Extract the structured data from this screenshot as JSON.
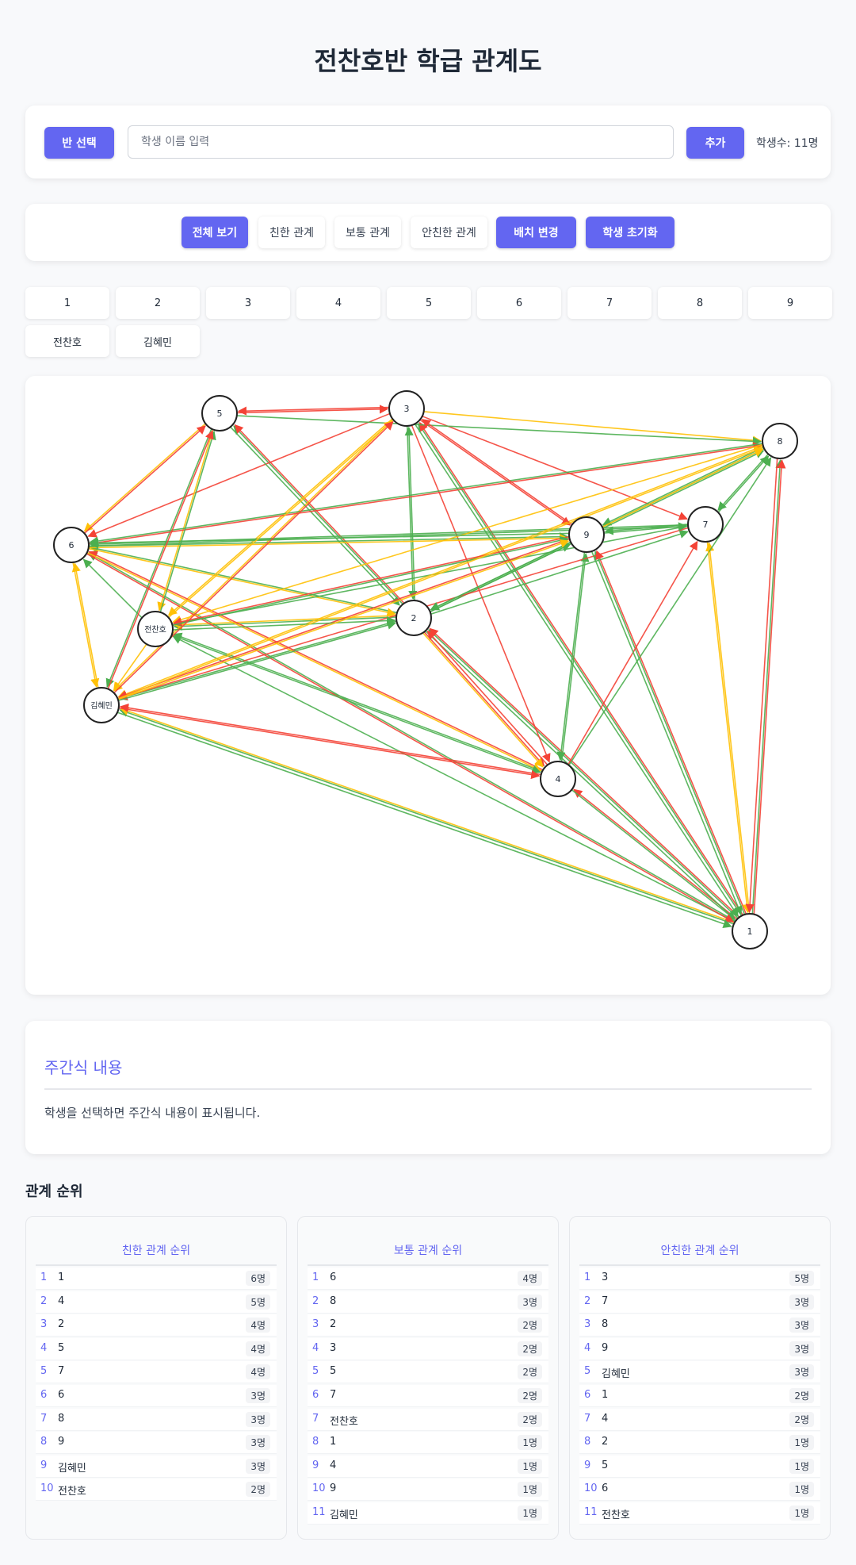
{
  "page": {
    "title": "전찬호반 학급 관계도"
  },
  "controls": {
    "class_select_label": "반 선택",
    "name_placeholder": "학생 이름 입력",
    "add_label": "추가",
    "student_count": "학생수: 11명"
  },
  "filters": {
    "all": "전체 보기",
    "close": "친한 관계",
    "normal": "보통 관계",
    "distant": "안친한 관계",
    "rearrange": "배치 변경",
    "reset": "학생 초기화"
  },
  "students": [
    "1",
    "2",
    "3",
    "4",
    "5",
    "6",
    "7",
    "8",
    "9",
    "전찬호",
    "김혜민"
  ],
  "colors": {
    "accent": "#6366f1",
    "close": "#4caf50",
    "normal": "#ffc107",
    "distant": "#f44336"
  },
  "graph": {
    "edges": [
      [
        "1",
        "8",
        "close"
      ],
      [
        "1",
        "8",
        "distant"
      ],
      [
        "1",
        "7",
        "normal"
      ],
      [
        "1",
        "9",
        "close"
      ],
      [
        "1",
        "9",
        "distant"
      ],
      [
        "1",
        "3",
        "close"
      ],
      [
        "1",
        "3",
        "distant"
      ],
      [
        "1",
        "4",
        "distant"
      ],
      [
        "1",
        "2",
        "close"
      ],
      [
        "1",
        "2",
        "distant"
      ],
      [
        "1",
        "6",
        "close"
      ],
      [
        "1",
        "전찬호",
        "close"
      ],
      [
        "1",
        "김혜민",
        "close"
      ],
      [
        "1",
        "김혜민",
        "normal"
      ],
      [
        "2",
        "3",
        "close"
      ],
      [
        "2",
        "5",
        "close"
      ],
      [
        "2",
        "5",
        "distant"
      ],
      [
        "2",
        "9",
        "close"
      ],
      [
        "2",
        "7",
        "close"
      ],
      [
        "2",
        "전찬호",
        "close"
      ],
      [
        "2",
        "전찬호",
        "normal"
      ],
      [
        "2",
        "김혜민",
        "close"
      ],
      [
        "2",
        "4",
        "distant"
      ],
      [
        "2",
        "4",
        "normal"
      ],
      [
        "2",
        "6",
        "close"
      ],
      [
        "2",
        "8",
        "close"
      ],
      [
        "2",
        "1",
        "close"
      ],
      [
        "3",
        "5",
        "distant"
      ],
      [
        "3",
        "8",
        "normal"
      ],
      [
        "3",
        "9",
        "distant"
      ],
      [
        "3",
        "7",
        "distant"
      ],
      [
        "3",
        "4",
        "distant"
      ],
      [
        "3",
        "6",
        "distant"
      ],
      [
        "3",
        "김혜민",
        "normal"
      ],
      [
        "3",
        "전찬호",
        "normal"
      ],
      [
        "3",
        "2",
        "close"
      ],
      [
        "3",
        "1",
        "close"
      ],
      [
        "4",
        "7",
        "distant"
      ],
      [
        "4",
        "8",
        "close"
      ],
      [
        "4",
        "9",
        "close"
      ],
      [
        "4",
        "김혜민",
        "distant"
      ],
      [
        "4",
        "6",
        "distant"
      ],
      [
        "4",
        "전찬호",
        "close"
      ],
      [
        "4",
        "2",
        "distant"
      ],
      [
        "4",
        "1",
        "close"
      ],
      [
        "5",
        "3",
        "distant"
      ],
      [
        "5",
        "8",
        "close"
      ],
      [
        "5",
        "6",
        "normal"
      ],
      [
        "5",
        "김혜민",
        "close"
      ],
      [
        "5",
        "전찬호",
        "normal"
      ],
      [
        "5",
        "2",
        "close"
      ],
      [
        "6",
        "8",
        "distant"
      ],
      [
        "6",
        "9",
        "close"
      ],
      [
        "6",
        "9",
        "normal"
      ],
      [
        "6",
        "7",
        "close"
      ],
      [
        "6",
        "5",
        "distant"
      ],
      [
        "6",
        "김혜민",
        "normal"
      ],
      [
        "6",
        "4",
        "normal"
      ],
      [
        "6",
        "2",
        "normal"
      ],
      [
        "6",
        "1",
        "distant"
      ],
      [
        "7",
        "8",
        "close"
      ],
      [
        "7",
        "9",
        "close"
      ],
      [
        "7",
        "김혜민",
        "distant"
      ],
      [
        "7",
        "전찬호",
        "close"
      ],
      [
        "7",
        "6",
        "close"
      ],
      [
        "7",
        "1",
        "normal"
      ],
      [
        "8",
        "7",
        "close"
      ],
      [
        "8",
        "9",
        "close"
      ],
      [
        "8",
        "6",
        "close"
      ],
      [
        "8",
        "전찬호",
        "normal"
      ],
      [
        "8",
        "김혜민",
        "normal"
      ],
      [
        "8",
        "2",
        "close"
      ],
      [
        "8",
        "1",
        "distant"
      ],
      [
        "9",
        "2",
        "close"
      ],
      [
        "9",
        "3",
        "distant"
      ],
      [
        "9",
        "전찬호",
        "distant"
      ],
      [
        "9",
        "김혜민",
        "distant"
      ],
      [
        "9",
        "6",
        "close"
      ],
      [
        "9",
        "1",
        "close"
      ],
      [
        "9",
        "4",
        "close"
      ],
      [
        "9",
        "7",
        "close"
      ],
      [
        "9",
        "8",
        "normal"
      ],
      [
        "전찬호",
        "2",
        "close"
      ],
      [
        "전찬호",
        "9",
        "close"
      ],
      [
        "전찬호",
        "5",
        "close"
      ],
      [
        "전찬호",
        "4",
        "close"
      ],
      [
        "전찬호",
        "김혜민",
        "normal"
      ],
      [
        "전찬호",
        "3",
        "normal"
      ],
      [
        "전찬호",
        "6",
        "close"
      ],
      [
        "김혜민",
        "6",
        "normal"
      ],
      [
        "김혜민",
        "3",
        "distant"
      ],
      [
        "김혜민",
        "9",
        "normal"
      ],
      [
        "김혜민",
        "4",
        "distant"
      ],
      [
        "김혜민",
        "5",
        "distant"
      ],
      [
        "김혜민",
        "8",
        "normal"
      ],
      [
        "김혜민",
        "2",
        "close"
      ],
      [
        "김혜민",
        "1",
        "close"
      ]
    ]
  },
  "journal": {
    "title": "주간식 내용",
    "placeholder": "학생을 선택하면 주간식 내용이 표시됩니다."
  },
  "ranking": {
    "heading": "관계 순위",
    "close": {
      "title": "친한 관계 순위",
      "rows": [
        {
          "rank": "1",
          "name": "1",
          "count": "6명"
        },
        {
          "rank": "2",
          "name": "4",
          "count": "5명"
        },
        {
          "rank": "3",
          "name": "2",
          "count": "4명"
        },
        {
          "rank": "4",
          "name": "5",
          "count": "4명"
        },
        {
          "rank": "5",
          "name": "7",
          "count": "4명"
        },
        {
          "rank": "6",
          "name": "6",
          "count": "3명"
        },
        {
          "rank": "7",
          "name": "8",
          "count": "3명"
        },
        {
          "rank": "8",
          "name": "9",
          "count": "3명"
        },
        {
          "rank": "9",
          "name": "김혜민",
          "count": "3명"
        },
        {
          "rank": "10",
          "name": "전찬호",
          "count": "2명"
        }
      ]
    },
    "normal": {
      "title": "보통 관계 순위",
      "rows": [
        {
          "rank": "1",
          "name": "6",
          "count": "4명"
        },
        {
          "rank": "2",
          "name": "8",
          "count": "3명"
        },
        {
          "rank": "3",
          "name": "2",
          "count": "2명"
        },
        {
          "rank": "4",
          "name": "3",
          "count": "2명"
        },
        {
          "rank": "5",
          "name": "5",
          "count": "2명"
        },
        {
          "rank": "6",
          "name": "7",
          "count": "2명"
        },
        {
          "rank": "7",
          "name": "전찬호",
          "count": "2명"
        },
        {
          "rank": "8",
          "name": "1",
          "count": "1명"
        },
        {
          "rank": "9",
          "name": "4",
          "count": "1명"
        },
        {
          "rank": "10",
          "name": "9",
          "count": "1명"
        },
        {
          "rank": "11",
          "name": "김혜민",
          "count": "1명"
        }
      ]
    },
    "distant": {
      "title": "안친한 관계 순위",
      "rows": [
        {
          "rank": "1",
          "name": "3",
          "count": "5명"
        },
        {
          "rank": "2",
          "name": "7",
          "count": "3명"
        },
        {
          "rank": "3",
          "name": "8",
          "count": "3명"
        },
        {
          "rank": "4",
          "name": "9",
          "count": "3명"
        },
        {
          "rank": "5",
          "name": "김혜민",
          "count": "3명"
        },
        {
          "rank": "6",
          "name": "1",
          "count": "2명"
        },
        {
          "rank": "7",
          "name": "4",
          "count": "2명"
        },
        {
          "rank": "8",
          "name": "2",
          "count": "1명"
        },
        {
          "rank": "9",
          "name": "5",
          "count": "1명"
        },
        {
          "rank": "10",
          "name": "6",
          "count": "1명"
        },
        {
          "rank": "11",
          "name": "전찬호",
          "count": "1명"
        }
      ]
    }
  }
}
